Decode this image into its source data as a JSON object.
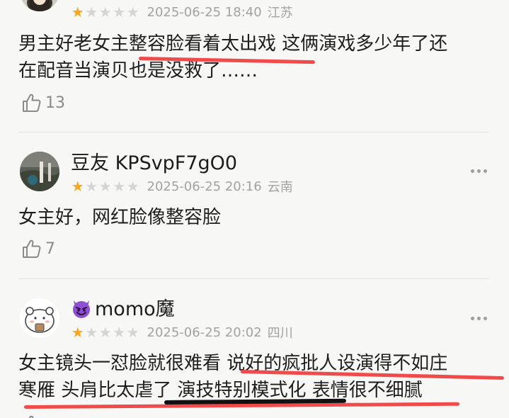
{
  "comments": [
    {
      "username": "",
      "rating": 1,
      "time": "2025-06-25 18:40",
      "location": "江苏",
      "text_lines": [
        "男主好老女主整容脸看着太出戏 这俩演戏多少年了还",
        "在配音当演贝也是没救了……"
      ],
      "likes": "13"
    },
    {
      "username": "豆友 KPSvpF7gO0",
      "rating": 1,
      "time": "2025-06-25 20:16",
      "location": "云南",
      "text_lines": [
        "女主好，网红脸像整容脸"
      ],
      "likes": "7"
    },
    {
      "username": "momo魔",
      "rating": 1,
      "time": "2025-06-25 20:02",
      "location": "四川",
      "text_lines": [
        "女主镜头一怼脸就很难看 说好的疯批人设演得不如庄",
        "寒雁 头肩比太虐了 演技特别模式化 表情很不细腻"
      ],
      "likes": ""
    }
  ],
  "colors": {
    "star_on": "#f5a623",
    "star_off": "#d4d4d4",
    "annotation_red": "#f04a4a",
    "annotation_black": "#111111"
  },
  "icons": {
    "like": "thumbs-up-icon",
    "more": "more-dots-icon",
    "emoji": "smiling-devil-emoji"
  }
}
